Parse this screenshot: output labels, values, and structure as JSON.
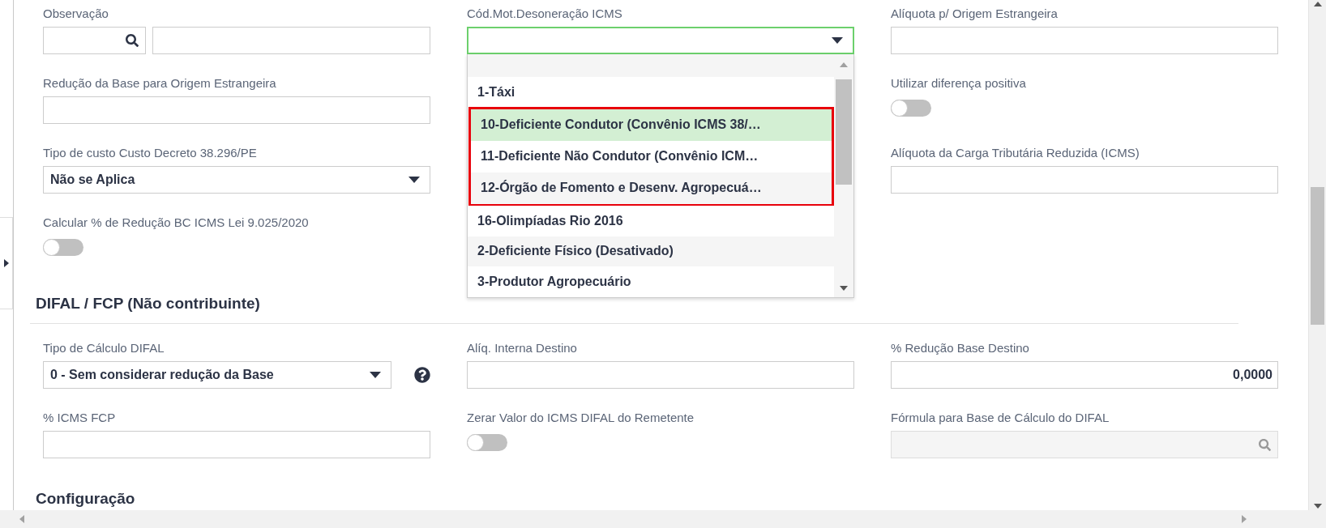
{
  "sections": [
    {
      "columns": [
        [
          {
            "kind": "lookup_pair",
            "label": "Observação"
          },
          {
            "kind": "text",
            "label": "Redução da Base para Origem Estrangeira"
          },
          {
            "kind": "select",
            "label": "Tipo de custo Custo Decreto 38.296/PE",
            "value": "Não se Aplica",
            "expanded": false
          },
          {
            "kind": "toggle",
            "label": "Calcular % de Redução BC ICMS Lei 9.025/2020",
            "on": false
          }
        ],
        [
          {
            "kind": "select",
            "label": "Cód.Mot.Desoneração ICMS",
            "expanded": true,
            "blank_option": true,
            "options": [
              {
                "text": "1-Táxi",
                "selected": false,
                "highlighted": false
              },
              {
                "text": "10-Deficiente Condutor (Convênio ICMS 38/…",
                "selected": true,
                "highlighted": true
              },
              {
                "text": "11-Deficiente Não Condutor (Convênio ICM…",
                "selected": false,
                "highlighted": true
              },
              {
                "text": "12-Órgão de Fomento e Desenv. Agropecuá…",
                "selected": false,
                "highlighted": true
              },
              {
                "text": "16-Olimpíadas Rio 2016",
                "selected": false,
                "highlighted": false
              },
              {
                "text": "2-Deficiente Físico (Desativado)",
                "selected": false,
                "highlighted": false
              },
              {
                "text": "3-Produtor Agropecuário",
                "selected": false,
                "highlighted": false
              }
            ]
          }
        ],
        [
          {
            "kind": "text",
            "label": "Alíquota p/ Origem Estrangeira"
          },
          {
            "kind": "toggle",
            "label": "Utilizar diferença positiva",
            "on": false
          },
          {
            "kind": "text",
            "label": "Alíquota da Carga Tributária Reduzida (ICMS)"
          }
        ]
      ]
    },
    {
      "title": "DIFAL / FCP (Não contribuinte)",
      "columns": [
        [
          {
            "kind": "select",
            "label": "Tipo de Cálculo DIFAL",
            "value": "0 - Sem considerar redução da Base",
            "expanded": false,
            "help": true
          },
          {
            "kind": "text",
            "label": "% ICMS FCP"
          }
        ],
        [
          {
            "kind": "text",
            "label": "Alíq. Interna Destino"
          },
          {
            "kind": "toggle",
            "label": "Zerar Valor do ICMS DIFAL do Remetente",
            "on": false
          }
        ],
        [
          {
            "kind": "text",
            "label": "% Redução Base Destino",
            "value": "0,0000"
          },
          {
            "kind": "lookup",
            "label": "Fórmula para Base de Cálculo do DIFAL",
            "disabled": true
          }
        ]
      ]
    },
    {
      "title": "Configuração"
    }
  ]
}
